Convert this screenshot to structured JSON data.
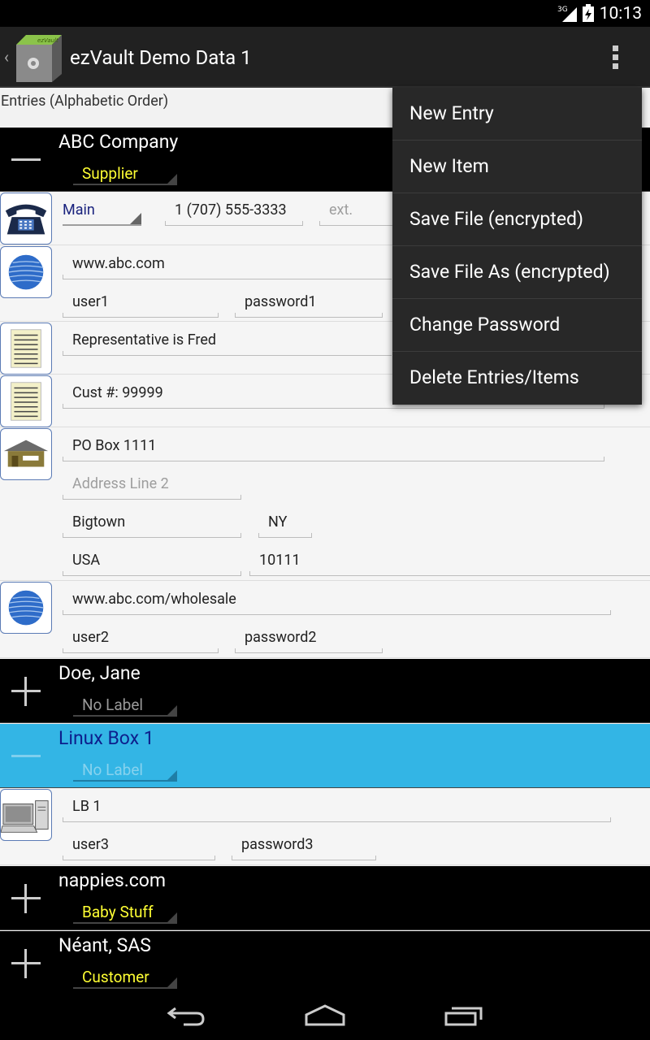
{
  "status_bar": {
    "time": "10:13",
    "network": "3G"
  },
  "action_bar": {
    "title": "ezVault Demo Data 1",
    "app_icon_text": "ezVault"
  },
  "list_header": "Entries (Alphabetic Order)",
  "entries": [
    {
      "name": "ABC Company",
      "label": "Supplier"
    },
    {
      "name": "Doe, Jane",
      "label": "No Label"
    },
    {
      "name": "Linux Box 1",
      "label": "No Label"
    },
    {
      "name": "nappies.com",
      "label": "Baby Stuff"
    },
    {
      "name": "Néant, SAS",
      "label": "Customer"
    }
  ],
  "abc_items": {
    "phone": {
      "type": "Main",
      "number": "1 (707) 555-3333",
      "ext_placeholder": "ext."
    },
    "web1": {
      "url": "www.abc.com",
      "user": "user1",
      "password": "password1"
    },
    "note1": "Representative is Fred",
    "note2": "Cust #: 99999",
    "address": {
      "line1": "PO Box 1111",
      "line2_placeholder": "Address Line 2",
      "city": "Bigtown",
      "state": "NY",
      "country": "USA",
      "zip": "10111"
    },
    "web2": {
      "url": "www.abc.com/wholesale",
      "user": "user2",
      "password": "password2"
    }
  },
  "linux_items": {
    "computer": {
      "name": "LB 1",
      "user": "user3",
      "password": "password3"
    }
  },
  "overflow_menu": [
    "New Entry",
    "New Item",
    "Save File (encrypted)",
    "Save File As (encrypted)",
    "Change Password",
    "Delete Entries/Items"
  ]
}
